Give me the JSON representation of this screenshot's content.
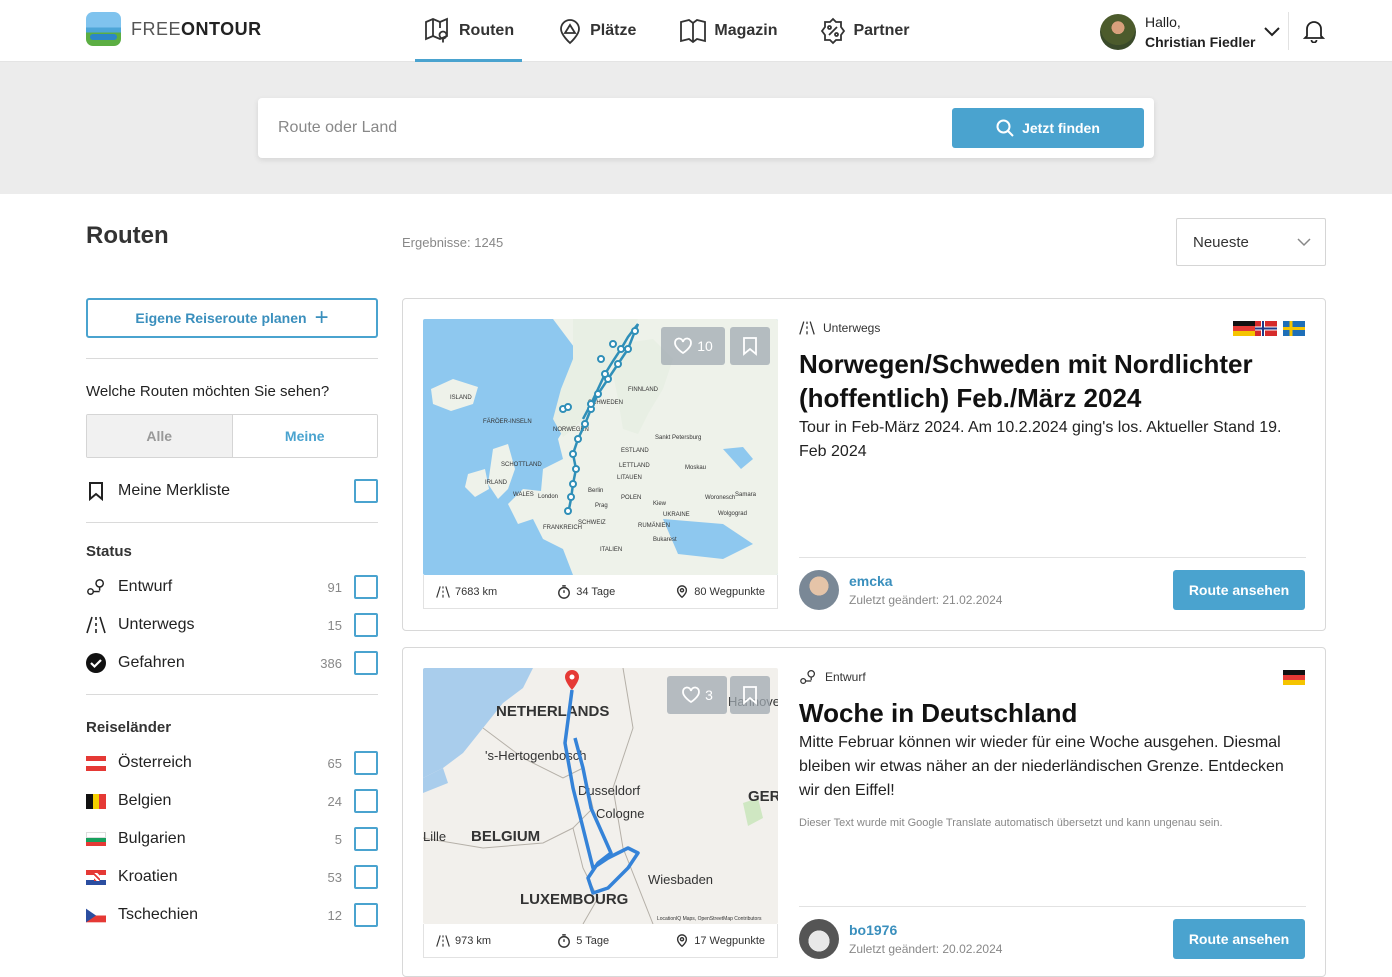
{
  "header": {
    "logo_light": "FREE",
    "logo_bold": "ONTOUR",
    "nav": [
      {
        "label": "Routen",
        "icon": "route-map-icon",
        "active": true
      },
      {
        "label": "Plätze",
        "icon": "place-pin-icon",
        "active": false
      },
      {
        "label": "Magazin",
        "icon": "book-icon",
        "active": false
      },
      {
        "label": "Partner",
        "icon": "percent-badge-icon",
        "active": false
      }
    ],
    "greeting": "Hallo,",
    "user_name": "Christian Fiedler"
  },
  "search": {
    "placeholder": "Route oder Land",
    "button_label": "Jetzt finden"
  },
  "page": {
    "title": "Routen",
    "results": "Ergebnisse: 1245",
    "sort_value": "Neueste"
  },
  "sidebar": {
    "plan_button": "Eigene Reiseroute planen",
    "question": "Welche Routen möchten Sie sehen?",
    "segments": [
      "Alle",
      "Meine"
    ],
    "merkliste": "Meine Merkliste",
    "status_title": "Status",
    "status": [
      {
        "label": "Entwurf",
        "count": "91"
      },
      {
        "label": "Unterwegs",
        "count": "15"
      },
      {
        "label": "Gefahren",
        "count": "386"
      }
    ],
    "countries_title": "Reiseländer",
    "countries": [
      {
        "label": "Österreich",
        "count": "65"
      },
      {
        "label": "Belgien",
        "count": "24"
      },
      {
        "label": "Bulgarien",
        "count": "5"
      },
      {
        "label": "Kroatien",
        "count": "53"
      },
      {
        "label": "Tschechien",
        "count": "12"
      }
    ]
  },
  "colors": {
    "accent": "#4aa3cf",
    "band": "#ececec"
  },
  "cards": [
    {
      "status": "Unterwegs",
      "title": "Norwegen/Schweden mit Nordlichter (hoffentlich) Feb./März 2024",
      "description": "Tour in Feb-März 2024. Am 10.2.2024 ging's los. Aktueller Stand 19. Feb 2024",
      "likes": "10",
      "distance": "7683 km",
      "duration": "34 Tage",
      "waypoints": "80 Wegpunkte",
      "author": "emcka",
      "updated": "Zuletzt geändert: 21.02.2024",
      "button": "Route ansehen",
      "map_labels": {
        "island": "ISLAND",
        "faroe": "FÄRÖER-INSELN",
        "norwegen": "NORWEGEN",
        "schweden": "SCHWEDEN",
        "finnland": "FINNLAND",
        "schottland": "SCHOTTLAND",
        "london": "London",
        "berlin": "Berlin",
        "prag": "Prag",
        "moskau": "Moskau",
        "stpetersburg": "Sankt Petersburg",
        "irland": "IRLAND",
        "estland": "ESTLAND",
        "lettland": "LETTLAND",
        "litauen": "LITAUEN",
        "polen": "POLEN",
        "ukraine": "UKRAINE",
        "kiew": "Kiew",
        "frankreich": "FRANKREICH",
        "italien": "ITALIEN",
        "rumaenien": "RUMÄNIEN",
        "bukarest": "Bukarest",
        "wolgograd": "Wolgograd",
        "samara": "Samara",
        "woronesch": "Woronesch",
        "schweiz": "SCHWEIZ",
        "wales": "WALES"
      }
    },
    {
      "status": "Entwurf",
      "title": "Woche in Deutschland",
      "description": "Mitte Februar können wir wieder für eine Woche ausgehen. Diesmal bleiben wir etwas näher an der niederländischen Grenze. Entdecken wir den Eiffel!",
      "translate_note": "Dieser Text wurde mit Google Translate automatisch übersetzt und kann ungenau sein.",
      "likes": "3",
      "distance": "973 km",
      "duration": "5 Tage",
      "waypoints": "17 Wegpunkte",
      "author": "bo1976",
      "updated": "Zuletzt geändert: 20.02.2024",
      "button": "Route ansehen",
      "map_labels": {
        "netherlands": "NETHERLANDS",
        "hertogenbosch": "'s-Hertogenbosch",
        "dusseldorf": "Dusseldorf",
        "cologne": "Cologne",
        "belgium": "BELGIUM",
        "luxembourg": "LUXEMBOURG",
        "wiesbaden": "Wiesbaden",
        "hannover": "Hannove",
        "ger": "GER",
        "lille": "Lille",
        "attribution": "LocationIQ Maps, OpenStreetMap Contributors"
      }
    }
  ]
}
